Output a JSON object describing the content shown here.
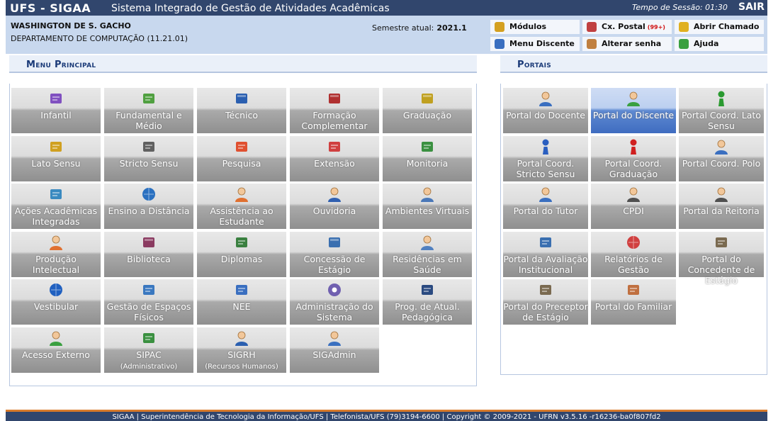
{
  "header": {
    "brand": "UFS - SIGAA",
    "subtitle": "Sistema Integrado de Gestão de Atividades Acadêmicas",
    "session_label": "Tempo de Sessão: 01:30",
    "logout": "SAIR"
  },
  "user": {
    "name": "WASHINGTON DE S. GACHO",
    "department": "DEPARTAMENTO DE COMPUTAÇÃO (11.21.01)",
    "semester_label": "Semestre atual:",
    "semester_value": "2021.1"
  },
  "quick_links": [
    {
      "label": "Módulos",
      "icon": "cube-icon",
      "color": "#d4a020"
    },
    {
      "label": "Cx. Postal",
      "badge": "(99+)",
      "icon": "mailbox-icon",
      "color": "#c04040"
    },
    {
      "label": "Abrir Chamado",
      "icon": "flashlight-icon",
      "color": "#e0b020"
    },
    {
      "label": "Menu Discente",
      "icon": "sitemap-icon",
      "color": "#3a6fc0"
    },
    {
      "label": "Alterar senha",
      "icon": "user-key-icon",
      "color": "#c08040"
    },
    {
      "label": "Ajuda",
      "icon": "help-icon",
      "color": "#3aa040"
    }
  ],
  "menu_principal": {
    "title": "Menu Principal",
    "items": [
      {
        "label": "Infantil",
        "icon": "crayons-icon",
        "color": "#8050c0"
      },
      {
        "label": "Fundamental e Médio",
        "icon": "pencil-icon",
        "color": "#50a040"
      },
      {
        "label": "Técnico",
        "icon": "book-blue-icon",
        "color": "#2a5fb0"
      },
      {
        "label": "Formação Complementar",
        "icon": "book-red-icon",
        "color": "#b03030"
      },
      {
        "label": "Graduação",
        "icon": "books-stack-icon",
        "color": "#c0a020"
      },
      {
        "label": "Lato Sensu",
        "icon": "folder-icon",
        "color": "#d0a020"
      },
      {
        "label": "Stricto Sensu",
        "icon": "briefcase-icon",
        "color": "#606060"
      },
      {
        "label": "Pesquisa",
        "icon": "flask-icon",
        "color": "#e05030"
      },
      {
        "label": "Extensão",
        "icon": "gift-icon",
        "color": "#d04040"
      },
      {
        "label": "Monitoria",
        "icon": "presentation-icon",
        "color": "#3a9040"
      },
      {
        "label": "Ações Acadêmicas Integradas",
        "icon": "puzzle-icon",
        "color": "#3a8ac0"
      },
      {
        "label": "Ensino a Distância",
        "icon": "globe-icon",
        "color": "#2a70c0"
      },
      {
        "label": "Assistência ao Estudante",
        "icon": "students-icon",
        "color": "#e07030"
      },
      {
        "label": "Ouvidoria",
        "icon": "headset-user-icon",
        "color": "#3060b0"
      },
      {
        "label": "Ambientes Virtuais",
        "icon": "network-users-icon",
        "color": "#4a78b8"
      },
      {
        "label": "Produção Intelectual",
        "icon": "user-check-icon",
        "color": "#e07030"
      },
      {
        "label": "Biblioteca",
        "icon": "library-book-icon",
        "color": "#8a3a60"
      },
      {
        "label": "Diplomas",
        "icon": "certificate-icon",
        "color": "#3a8040"
      },
      {
        "label": "Concessão de Estágio",
        "icon": "notebook-icon",
        "color": "#3a6fb0"
      },
      {
        "label": "Residências em Saúde",
        "icon": "doctor-icon",
        "color": "#5080c0"
      },
      {
        "label": "Vestibular",
        "icon": "swirl-icon",
        "color": "#2060c0"
      },
      {
        "label": "Gestão de Espaços Físicos",
        "icon": "sitemap-icon",
        "color": "#3a78c0"
      },
      {
        "label": "NEE",
        "icon": "wheelchair-icon",
        "color": "#3a6fc0"
      },
      {
        "label": "Administração do Sistema",
        "icon": "gear-icon",
        "color": "#7060b0"
      },
      {
        "label": "Prog. de Atual. Pedagógica",
        "icon": "monitor-icon",
        "color": "#2a4a80"
      },
      {
        "label": "Acesso Externo",
        "icon": "user-green-icon",
        "color": "#3aa040"
      },
      {
        "label": "SIPAC",
        "sub": "(Administrativo)",
        "icon": "box-arrows-icon",
        "color": "#3a9040"
      },
      {
        "label": "SIGRH",
        "sub": "(Recursos Humanos)",
        "icon": "user-blue-icon",
        "color": "#2a5fb0"
      },
      {
        "label": "SIGAdmin",
        "icon": "user-screen-icon",
        "color": "#3a70c0"
      }
    ]
  },
  "portais": {
    "title": "Portais",
    "items": [
      {
        "label": "Portal do Docente",
        "icon": "user-blue-icon",
        "color": "#3a6fc0",
        "selected": false
      },
      {
        "label": "Portal do Discente",
        "icon": "user-green-icon",
        "color": "#3aa040",
        "selected": true
      },
      {
        "label": "Portal Coord. Lato Sensu",
        "icon": "pawn-green-icon",
        "color": "#2a9a30",
        "selected": false
      },
      {
        "label": "Portal Coord. Stricto Sensu",
        "icon": "pawn-blue-icon",
        "color": "#2a5fc0",
        "selected": false
      },
      {
        "label": "Portal Coord. Graduação",
        "icon": "pawn-red-icon",
        "color": "#d02020",
        "selected": false
      },
      {
        "label": "Portal Coord. Polo",
        "icon": "user-blue-icon",
        "color": "#3a6fc0",
        "selected": false
      },
      {
        "label": "Portal do Tutor",
        "icon": "user-blue-icon",
        "color": "#3a6fc0",
        "selected": false
      },
      {
        "label": "CPDI",
        "icon": "user-suit-icon",
        "color": "#505050",
        "selected": false
      },
      {
        "label": "Portal da Reitoria",
        "icon": "user-suit-icon",
        "color": "#505050",
        "selected": false
      },
      {
        "label": "Portal da Avaliação Institucional",
        "icon": "document-check-icon",
        "color": "#3a6fb0",
        "selected": false
      },
      {
        "label": "Relatórios de Gestão",
        "icon": "chart-pie-icon",
        "color": "#d04040",
        "selected": false
      },
      {
        "label": "Portal do Concedente de Estágio",
        "icon": "id-card-icon",
        "color": "#7a6a50",
        "selected": false
      },
      {
        "label": "Portal do Preceptor de Estágio",
        "icon": "id-card-icon",
        "color": "#7a6a50",
        "selected": false
      },
      {
        "label": "Portal do Familiar",
        "icon": "family-icon",
        "color": "#c07040",
        "selected": false
      }
    ]
  },
  "footer": {
    "text": "SIGAA | Superintendência de Tecnologia da Informação/UFS | Telefonista/UFS (79)3194-6600 | Copyright © 2009-2021 - UFRN v3.5.16 -r16236-ba0f807fd2"
  }
}
